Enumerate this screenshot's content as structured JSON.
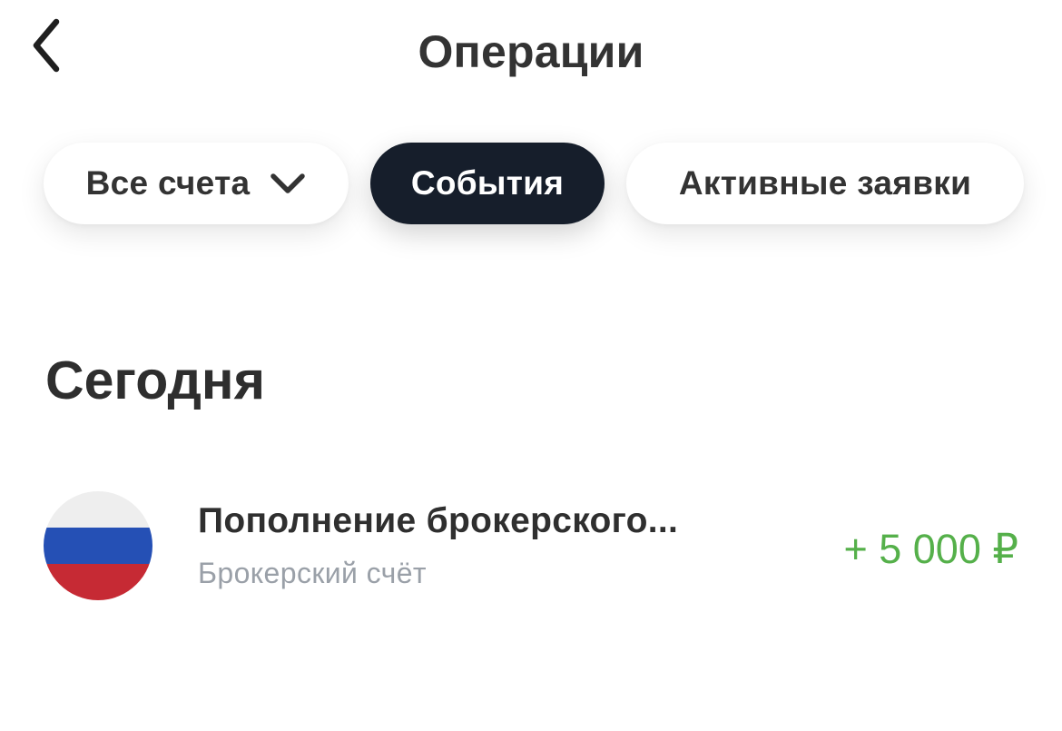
{
  "header": {
    "title": "Операции",
    "back_icon": "chevron-left-icon"
  },
  "filters": {
    "accounts_label": "Все счета",
    "accounts_icon": "chevron-down-icon",
    "events_label": "События",
    "orders_label": "Активные заявки",
    "selected": "События"
  },
  "section": {
    "title": "Сегодня"
  },
  "operations": [
    {
      "title": "Пополнение брокерского...",
      "subtitle": "Брокерский счёт",
      "amount": "+ 5 000 ₽",
      "icon": "russia-flag-icon"
    }
  ],
  "colors": {
    "dark_chip": "#161e2b",
    "amount_positive": "#55b04a",
    "subtitle": "#9aa0a8",
    "flag_white": "#eeeeee",
    "flag_blue": "#2550b5",
    "flag_red": "#c62a34"
  }
}
